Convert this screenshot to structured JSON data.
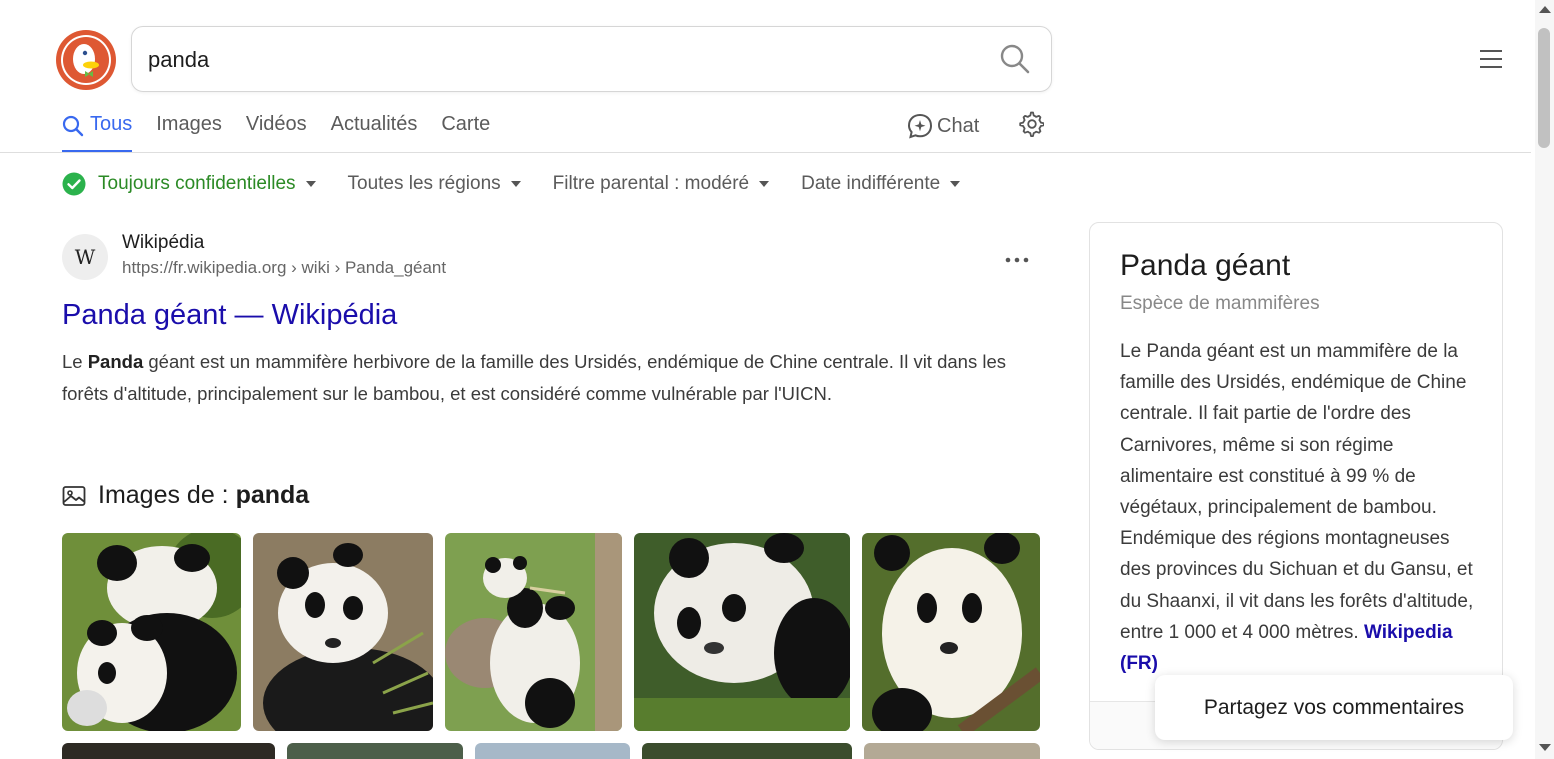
{
  "search": {
    "query": "panda",
    "placeholder": ""
  },
  "tabs": [
    {
      "label": "Tous",
      "active": true
    },
    {
      "label": "Images"
    },
    {
      "label": "Vidéos"
    },
    {
      "label": "Actualités"
    },
    {
      "label": "Carte"
    }
  ],
  "chat_label": "Chat",
  "filters": {
    "privacy": "Toujours confidentielles",
    "region": "Toutes les régions",
    "parental": "Filtre parental : modéré",
    "date": "Date indifférente"
  },
  "result": {
    "favicon_letter": "W",
    "site_name": "Wikipédia",
    "url": "https://fr.wikipedia.org › wiki › Panda_géant",
    "title": "Panda géant — Wikipédia",
    "snippet_prefix": "Le ",
    "snippet_bold": "Panda",
    "snippet_rest": " géant est un mammifère herbivore de la famille des Ursidés, endémique de Chine centrale. Il vit dans les forêts d'altitude, principalement sur le bambou, et est considéré comme vulnérable par l'UICN."
  },
  "images_section": {
    "prefix": "Images de : ",
    "query": "panda"
  },
  "knowledge_panel": {
    "title": "Panda géant",
    "subtitle": "Espèce de mammifères",
    "text": "Le Panda géant est un mammifère de la famille des Ursidés, endémique de Chine centrale. Il fait partie de l'ordre des Carnivores, même si son régime alimentaire est constitué à 99 % de végétaux, principalement de bambou. Endémique des régions montagneuses des provinces du Sichuan et du Gansu, et du Shaanxi, il vit dans les forêts d'altitude, entre 1 000 et 4 000 mètres. ",
    "link": "Wikipedia (FR)"
  },
  "feedback_label": "Partagez vos commentaires",
  "colors": {
    "accent": "#3969ef",
    "link": "#1a0dab",
    "privacy_green": "#2b8a25",
    "logo_orange": "#de5833"
  }
}
